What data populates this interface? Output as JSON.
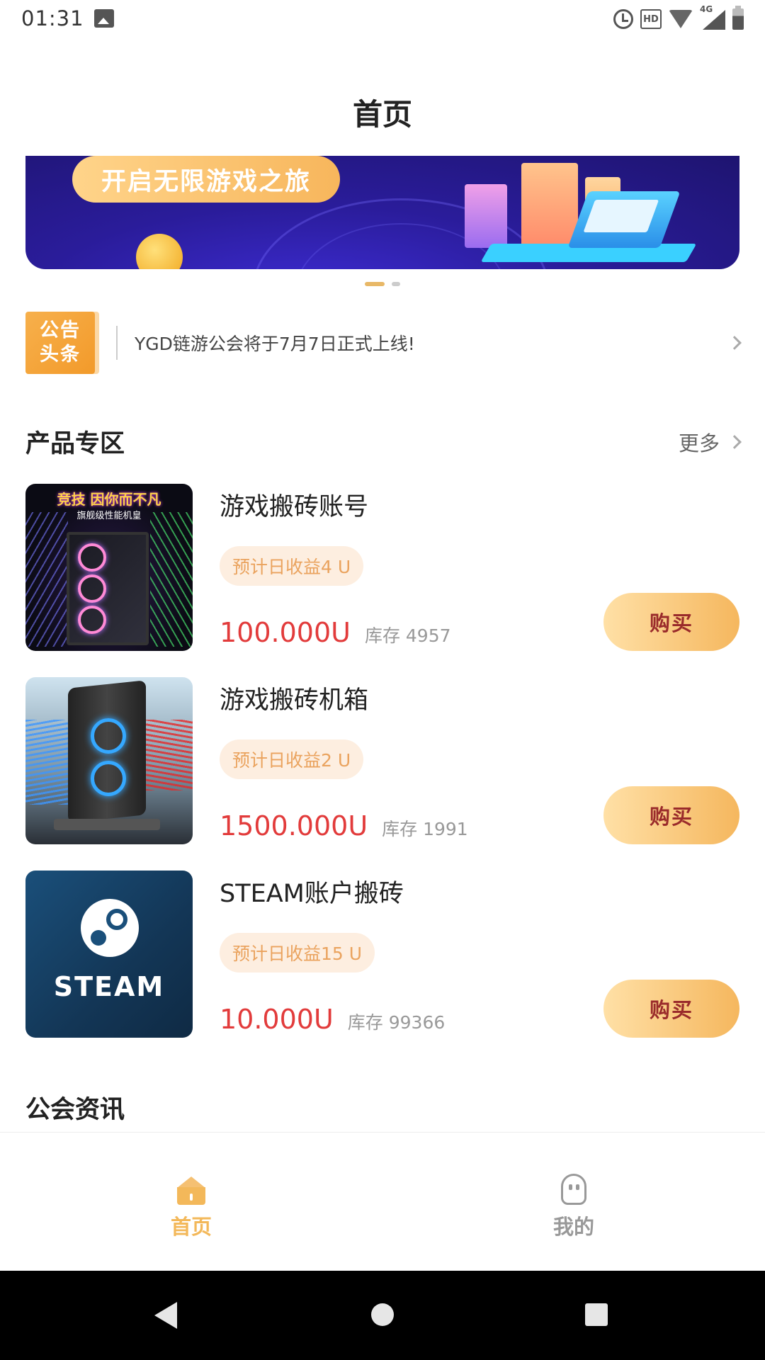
{
  "status_bar": {
    "time": "01:31",
    "network": "4G",
    "hd_label": "HD"
  },
  "header": {
    "title": "首页"
  },
  "banner": {
    "slogan": "开启无限游戏之旅",
    "pages": 2,
    "active_page": 1
  },
  "notice": {
    "badge_line1": "公告",
    "badge_line2": "头条",
    "text": "YGD链游公会将于7月7日正式上线!"
  },
  "products_section": {
    "title": "产品专区",
    "more_label": "更多"
  },
  "products": [
    {
      "name": "游戏搬砖账号",
      "tag": "预计日收益4 U",
      "price": "100.000U",
      "stock": "库存 4957",
      "buy_label": "购买",
      "thumb_line1": "竞技 因你而不凡",
      "thumb_line2": "旗舰级性能机皇"
    },
    {
      "name": "游戏搬砖机箱",
      "tag": "预计日收益2 U",
      "price": "1500.000U",
      "stock": "库存 1991",
      "buy_label": "购买"
    },
    {
      "name": "STEAM账户搬砖",
      "tag": "预计日收益15 U",
      "price": "10.000U",
      "stock": "库存 99366",
      "buy_label": "购买",
      "thumb_word": "STEAM"
    }
  ],
  "news_section": {
    "title": "公会资讯"
  },
  "bottom_nav": [
    {
      "label": "首页",
      "active": true,
      "color": "#f3b85a"
    },
    {
      "label": "我的",
      "active": false,
      "color": "#999999"
    }
  ]
}
